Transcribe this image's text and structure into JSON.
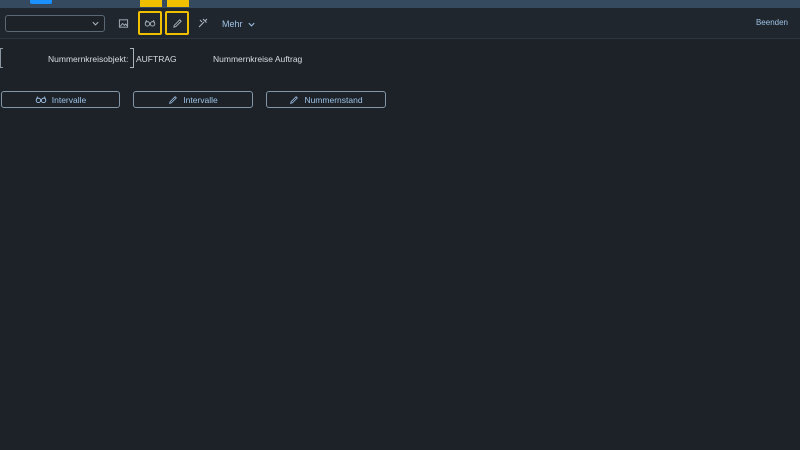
{
  "toolbar": {
    "select_value": "",
    "more_label": "Mehr",
    "exit_label": "Beenden"
  },
  "content": {
    "field_label": "Nummernkreisobjekt:",
    "field_value": "AUFTRAG",
    "field_description": "Nummernkreise Auftrag"
  },
  "actions": [
    {
      "label": "Intervalle",
      "icon": "glasses-icon"
    },
    {
      "label": "Intervalle",
      "icon": "pencil-icon"
    },
    {
      "label": "Nummernstand",
      "icon": "pencil-icon"
    }
  ],
  "colors": {
    "background": "#1c2228",
    "shell": "#354a5f",
    "highlight": "#f0c000",
    "link": "#9fc2e6"
  }
}
